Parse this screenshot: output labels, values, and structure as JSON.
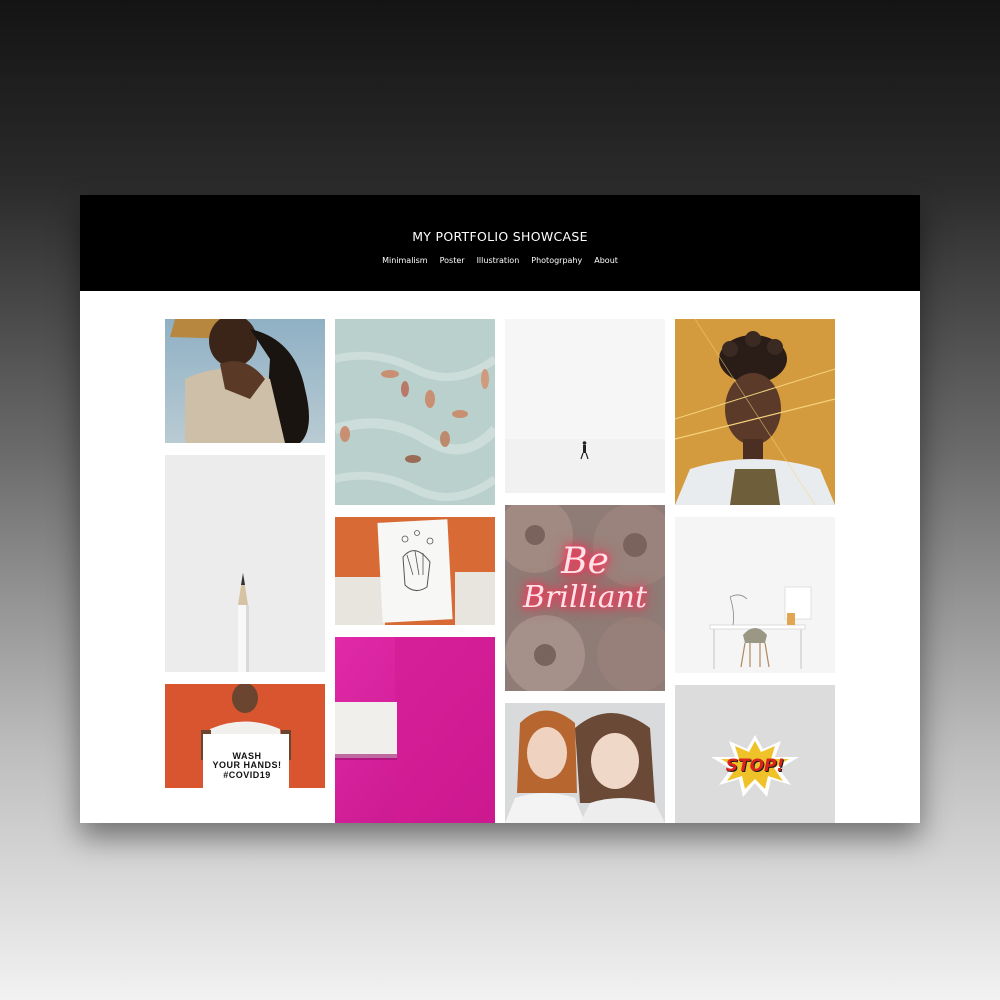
{
  "site": {
    "title": "MY PORTFOLIO SHOWCASE",
    "nav": [
      {
        "label": "Minimalism"
      },
      {
        "label": "Poster"
      },
      {
        "label": "Illustration"
      },
      {
        "label": "Photogrpahy"
      },
      {
        "label": "About"
      }
    ]
  },
  "gallery": {
    "tiles": [
      {
        "subject": "woman in straw hat"
      },
      {
        "subject": "swimmers from above"
      },
      {
        "subject": "lone figure in white"
      },
      {
        "subject": "portrait with yellow strings"
      },
      {
        "subject": "white pencil"
      },
      {
        "subject": "hands drawing"
      },
      {
        "subject": "neon sign"
      },
      {
        "subject": "minimal desk"
      },
      {
        "subject": "man with sign"
      },
      {
        "subject": "magenta paper"
      },
      {
        "subject": "two women"
      },
      {
        "subject": "stop sticker"
      }
    ],
    "sign_lines": [
      "WASH",
      "YOUR HANDS!",
      "#COVID19"
    ],
    "neon_lines": [
      "Be",
      "Brilliant"
    ],
    "sticker_text": "STOP!"
  },
  "colors": {
    "header_bg": "#000000",
    "page_bg": "#ffffff",
    "accent_orange": "#d8552f",
    "accent_magenta": "#d61a9c",
    "mustard": "#d49b3e"
  }
}
